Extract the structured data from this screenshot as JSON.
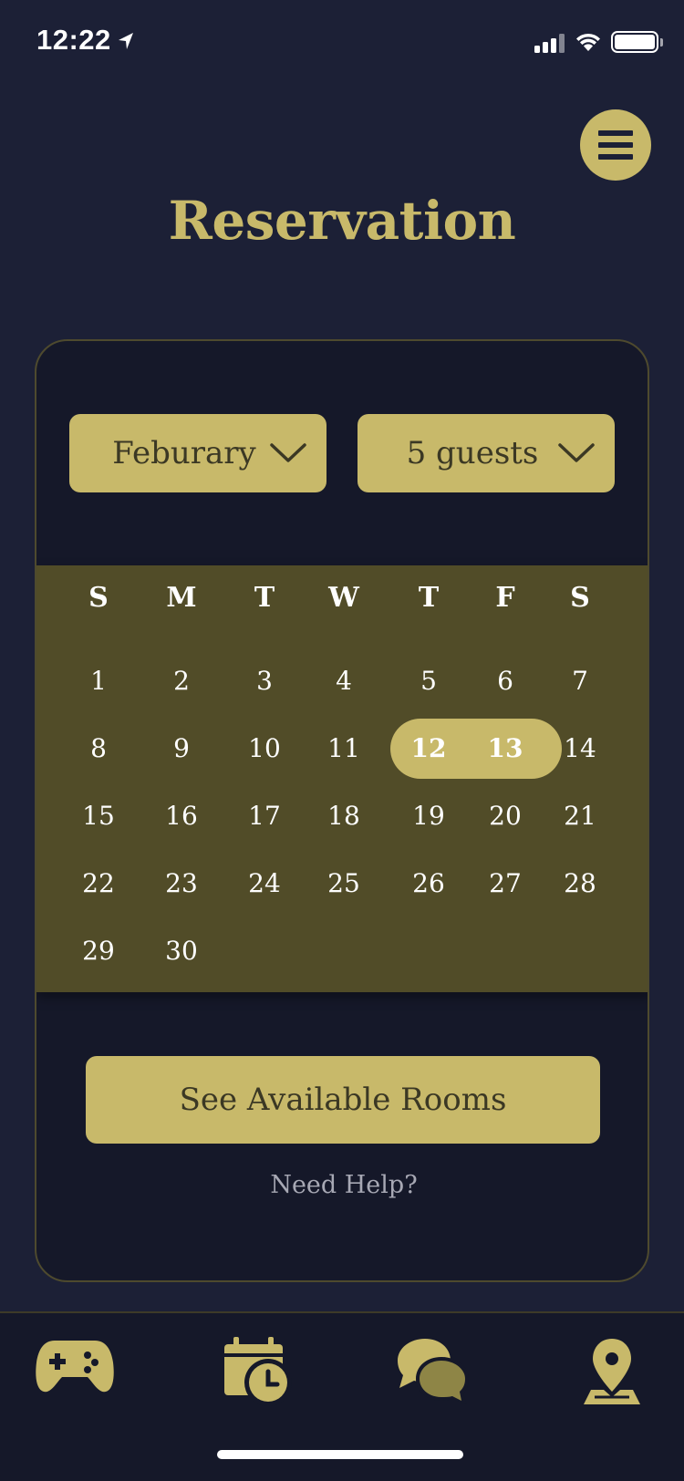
{
  "status_bar": {
    "time": "12:22",
    "battery_level": 1.0
  },
  "header": {
    "title": "Reservation",
    "menu_icon": "hamburger-menu-icon"
  },
  "filters": {
    "month": {
      "value": "Feburary"
    },
    "guests": {
      "value": "5 guests"
    }
  },
  "calendar": {
    "weekdays": [
      "S",
      "M",
      "T",
      "W",
      "T",
      "F",
      "S"
    ],
    "days": [
      "1",
      "2",
      "3",
      "4",
      "5",
      "6",
      "7",
      "8",
      "9",
      "10",
      "11",
      "12",
      "13",
      "14",
      "15",
      "16",
      "17",
      "18",
      "19",
      "20",
      "21",
      "22",
      "23",
      "24",
      "25",
      "26",
      "27",
      "28",
      "29",
      "30"
    ],
    "first_weekday_index": 0,
    "selected_range": [
      "12",
      "13"
    ]
  },
  "actions": {
    "primary_label": "See Available Rooms",
    "help_label": "Need Help?"
  },
  "tab_bar": {
    "items": [
      {
        "icon": "gamepad-icon",
        "active": false
      },
      {
        "icon": "calendar-clock-icon",
        "active": true
      },
      {
        "icon": "chat-bubbles-icon",
        "active": false
      },
      {
        "icon": "map-pin-icon",
        "active": false
      }
    ]
  },
  "colors": {
    "background": "#1c2036",
    "card": "#151829",
    "accent": "#c8b96a",
    "calendar_panel": "#514c28",
    "dark_text": "#3b3824",
    "muted_text": "#a7a8b4"
  }
}
